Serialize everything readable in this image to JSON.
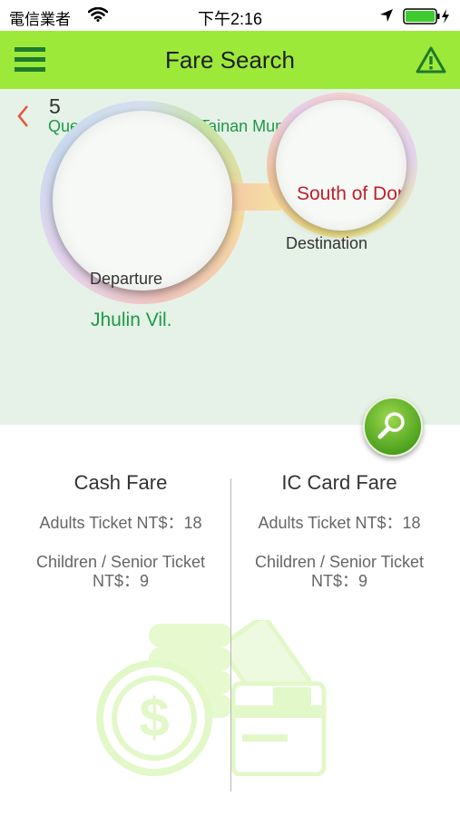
{
  "status_bar": {
    "carrier": "電信業者",
    "time": "下午2:16"
  },
  "nav": {
    "title": "Fare Search",
    "menu_icon": "hamburger-menu-icon",
    "alert_icon": "warning-icon"
  },
  "route": {
    "number": "5",
    "name": "Queena Plaza Hotel-Tainan Municipal Hospital",
    "back_icon": "chevron-left-icon"
  },
  "departure": {
    "label": "Departure",
    "value": "Jhulin Vil."
  },
  "destination": {
    "label": "Destination",
    "value": "South of Dongning Rd."
  },
  "fares": {
    "cash": {
      "title": "Cash Fare",
      "adult": "Adults Ticket NT$：18",
      "child_line1": "Children / Senior Ticket",
      "child_line2": "NT$：9"
    },
    "ic_card": {
      "title": "IC Card Fare",
      "adult": "Adults Ticket NT$：18",
      "child_line1": "Children / Senior Ticket",
      "child_line2": "NT$：9"
    }
  },
  "colors": {
    "nav_green": "#9de93a",
    "route_green": "#1c9a45",
    "destination_red": "#c0202a",
    "back_red": "#e8523c"
  }
}
